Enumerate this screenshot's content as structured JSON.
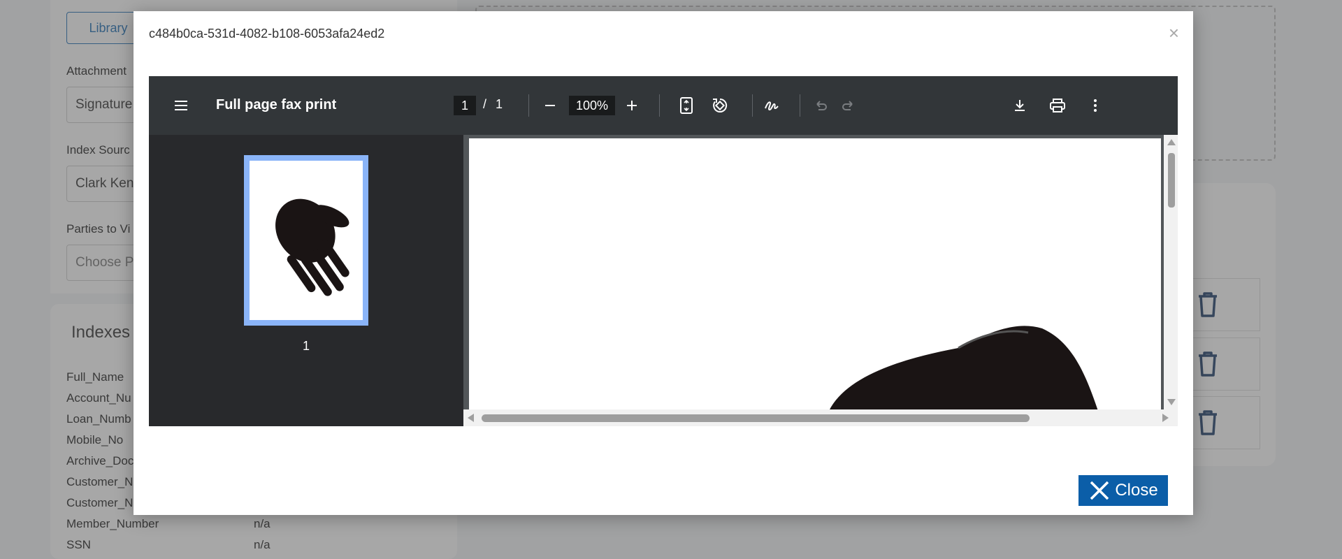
{
  "background": {
    "library_button": "Library",
    "labels": {
      "attachment": "Attachment",
      "index_source": "Index Sourc",
      "parties": "Parties to Vi"
    },
    "fields": {
      "attachment_value": "Signature",
      "index_source_value": "Clark Ken",
      "parties_placeholder": "Choose P"
    },
    "indexes": {
      "title": "Indexes",
      "rows": [
        {
          "key": "Full_Name",
          "value": ""
        },
        {
          "key": "Account_Nu",
          "value": ""
        },
        {
          "key": "Loan_Numb",
          "value": ""
        },
        {
          "key": "Mobile_No",
          "value": ""
        },
        {
          "key": "Archive_Doc",
          "value": ""
        },
        {
          "key": "Customer_N",
          "value": ""
        },
        {
          "key": "Customer_N",
          "value": ""
        },
        {
          "key": "Member_Number",
          "value": "n/a"
        },
        {
          "key": "SSN",
          "value": "n/a"
        }
      ]
    }
  },
  "modal": {
    "title": "c484b0ca-531d-4082-b108-6053afa24ed2",
    "close_label": "Close",
    "viewer": {
      "document_title": "Full page fax print",
      "current_page": "1",
      "page_separator": "/",
      "total_pages": "1",
      "zoom": "100%",
      "thumbnail_label": "1"
    }
  },
  "colors": {
    "accent": "#0b5ea8",
    "toolbar": "#323639",
    "sidebar": "#28292c",
    "thumb_border": "#8ab4f8"
  }
}
